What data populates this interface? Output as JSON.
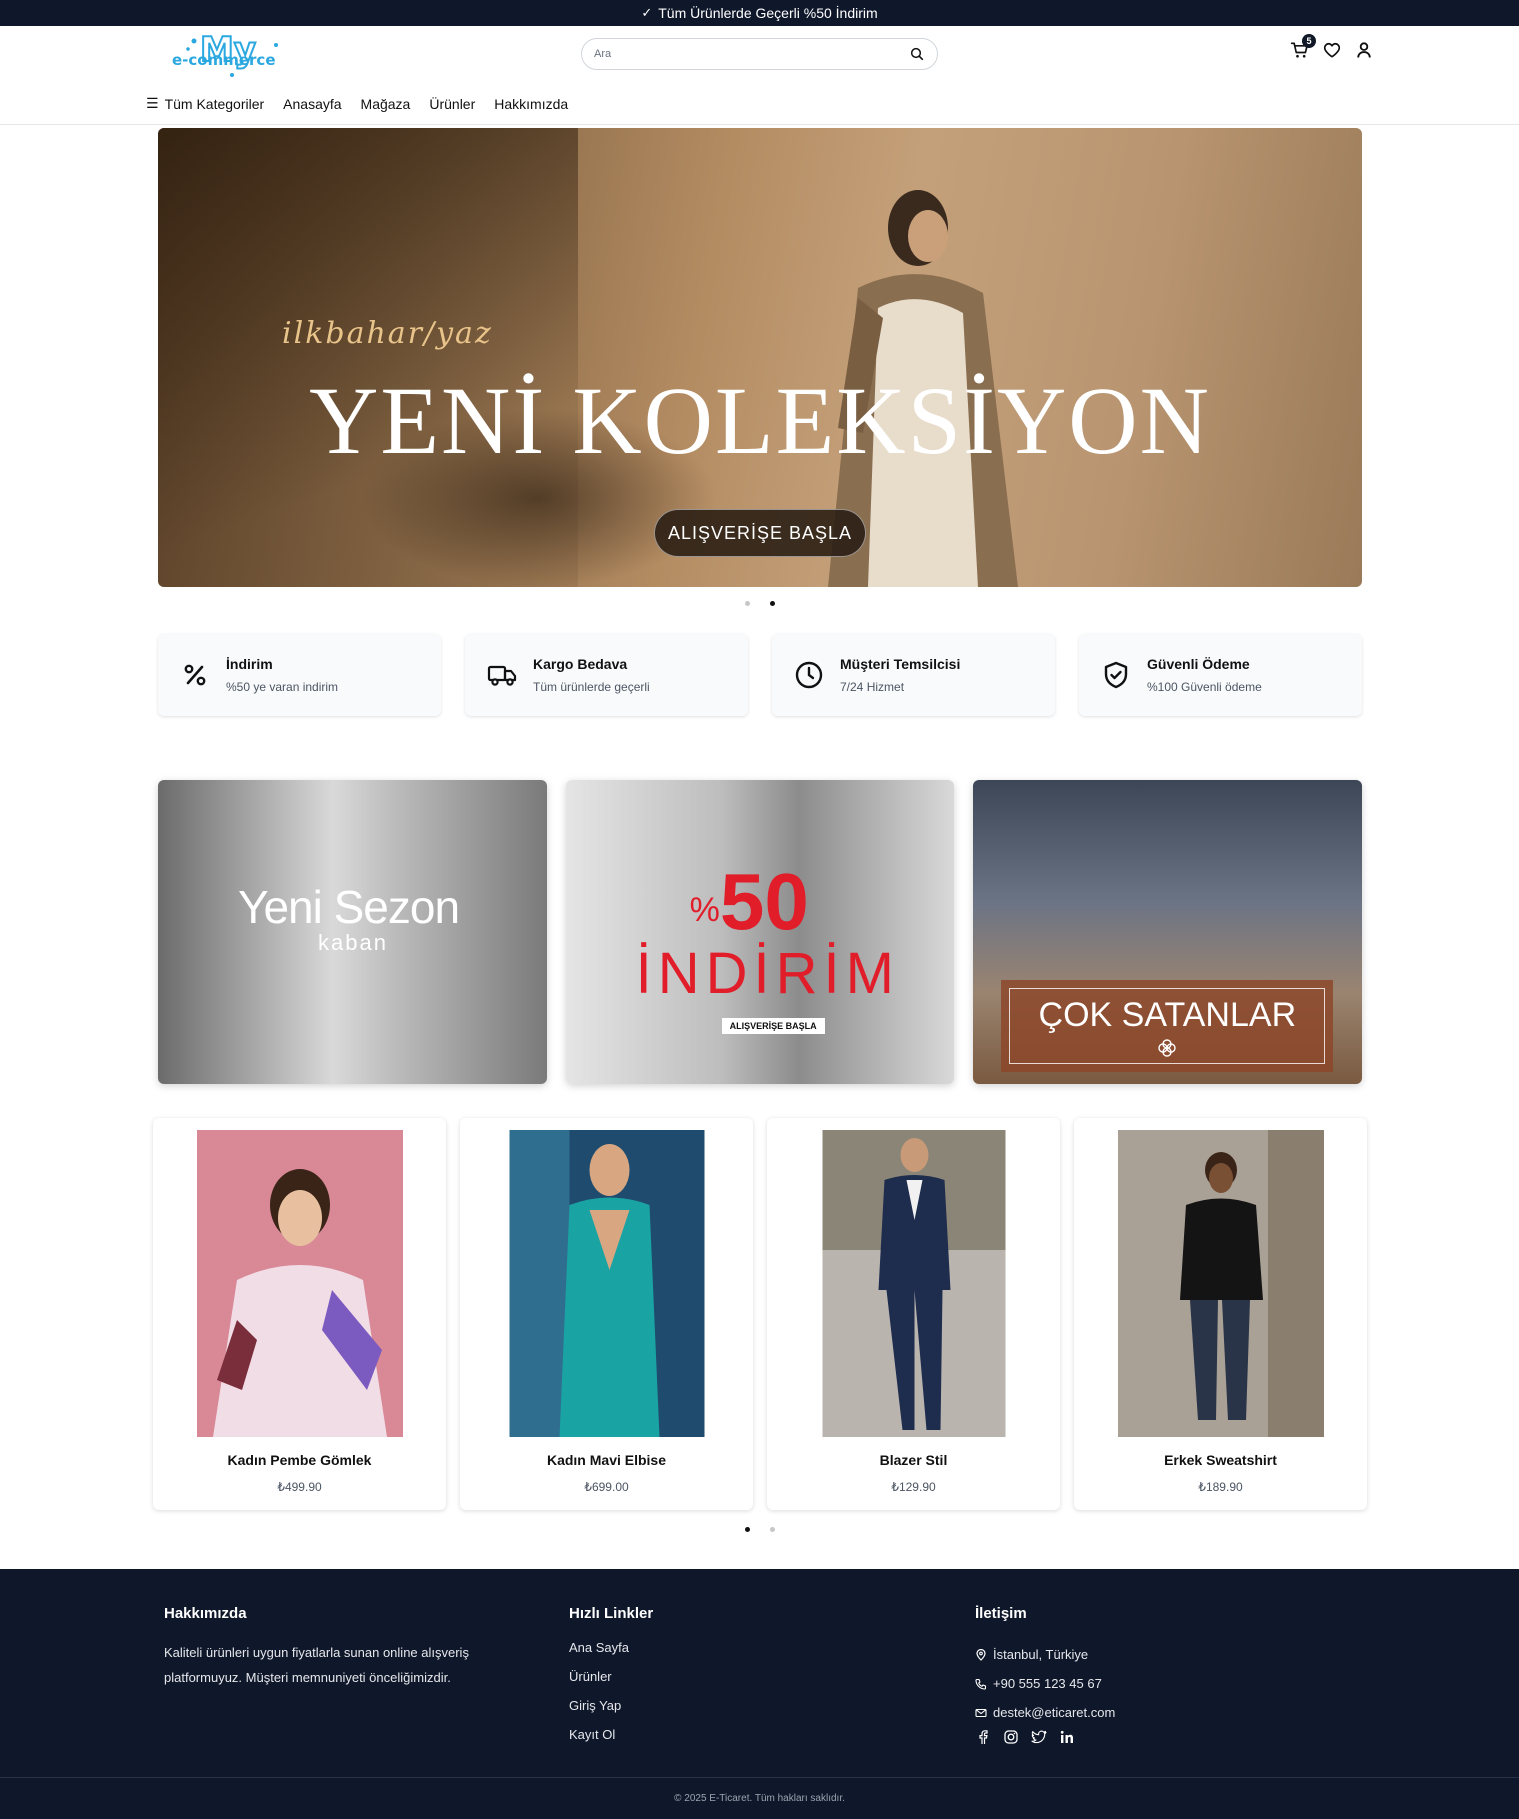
{
  "topbar": {
    "check_icon": "check-icon",
    "text": "Tüm Ürünlerde Geçerli %50 İndirim"
  },
  "header": {
    "logo_text": "My e-commerce",
    "search": {
      "placeholder": "Ara",
      "value": ""
    },
    "cart_count": "5",
    "icons": [
      "cart-icon",
      "heart-icon",
      "user-icon"
    ]
  },
  "nav": {
    "all_categories": "Tüm Kategoriler",
    "items": [
      "Anasayfa",
      "Mağaza",
      "Ürünler",
      "Hakkımızda"
    ]
  },
  "hero": {
    "script": "ilkbahar/yaz",
    "headline": "YENİ KOLEKSİYON",
    "cta": "ALIŞVERİŞE BAŞLA",
    "slide_count": 2,
    "active_slide": 2
  },
  "features": [
    {
      "icon": "percent-icon",
      "title": "İndirim",
      "subtitle": "%50 ye varan indirim"
    },
    {
      "icon": "truck-icon",
      "title": "Kargo Bedava",
      "subtitle": "Tüm ürünlerde geçerli"
    },
    {
      "icon": "clock-icon",
      "title": "Müşteri Temsilcisi",
      "subtitle": "7/24 Hizmet"
    },
    {
      "icon": "shield-check-icon",
      "title": "Güvenli Ödeme",
      "subtitle": "%100 Güvenli ödeme"
    }
  ],
  "banners": {
    "new_season": {
      "title": "Yeni Sezon",
      "subtitle": "kaban"
    },
    "discount": {
      "percent_sign": "%",
      "number": "50",
      "word": "İNDİRİM",
      "cta": "ALIŞVERİŞE BAŞLA"
    },
    "best_sellers": {
      "title": "ÇOK SATANLAR"
    }
  },
  "products": [
    {
      "name": "Kadın Pembe Gömlek",
      "price": "₺499.90"
    },
    {
      "name": "Kadın Mavi Elbise",
      "price": "₺699.00"
    },
    {
      "name": "Blazer Stil",
      "price": "₺129.90"
    },
    {
      "name": "Erkek Sweatshirt",
      "price": "₺189.90"
    }
  ],
  "products_slider": {
    "slide_count": 2,
    "active_slide": 1
  },
  "footer": {
    "about": {
      "title": "Hakkımızda",
      "text_line1": "Kaliteli ürünleri uygun fiyatlarla sunan online alışveriş",
      "text_line2": "platformuyuz. Müşteri memnuniyeti önceliğimizdir."
    },
    "links": {
      "title": "Hızlı Linkler",
      "items": [
        "Ana Sayfa",
        "Ürünler",
        "Giriş Yap",
        "Kayıt Ol"
      ]
    },
    "contact": {
      "title": "İletişim",
      "address": "İstanbul, Türkiye",
      "phone": "+90 555 123 45 67",
      "email": "destek@eticaret.com",
      "social": [
        "facebook-icon",
        "instagram-icon",
        "twitter-icon",
        "linkedin-icon"
      ]
    },
    "copyright": "© 2025 E-Ticaret. Tüm hakları saklıdır."
  },
  "colors": {
    "dark": "#0f172a",
    "accent_red": "#e11d2a",
    "logo_blue": "#2ba8e0"
  }
}
